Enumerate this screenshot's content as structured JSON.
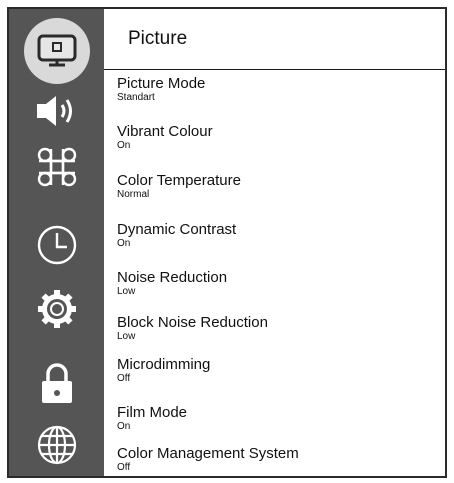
{
  "header": {
    "title": "Picture"
  },
  "sidebar": {
    "icons": [
      {
        "icon": "picture-icon",
        "active": true
      },
      {
        "icon": "sound-icon"
      },
      {
        "icon": "command-icon"
      },
      {
        "icon": "clock-icon"
      },
      {
        "icon": "gear-icon"
      },
      {
        "icon": "lock-icon"
      },
      {
        "icon": "globe-icon"
      }
    ]
  },
  "colors": {
    "sidebar_bg": "#555555",
    "active_bubble": "#d9d9d9",
    "text": "#111111"
  },
  "items": [
    {
      "label": "Picture Mode",
      "value": "Standart"
    },
    {
      "label": "Vibrant Colour",
      "value": "On"
    },
    {
      "label": "Color Temperature",
      "value": "Normal"
    },
    {
      "label": "Dynamic Contrast",
      "value": "On"
    },
    {
      "label": "Noise Reduction",
      "value": "Low"
    },
    {
      "label": "Block Noise Reduction",
      "value": "Low"
    },
    {
      "label": "Microdimming",
      "value": "Off"
    },
    {
      "label": "Film Mode",
      "value": "On"
    },
    {
      "label": "Color Management System",
      "value": "Off"
    }
  ]
}
